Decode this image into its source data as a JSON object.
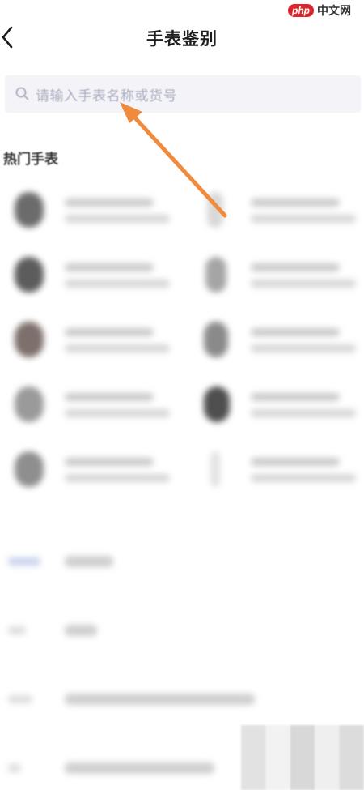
{
  "header": {
    "title": "手表鉴别",
    "back_icon": "chevron-left-icon"
  },
  "watermark": {
    "logo": "php",
    "text": "中文网"
  },
  "search": {
    "placeholder": "请输入手表名称或货号",
    "icon": "search-icon"
  },
  "section": {
    "title": "热门手表"
  },
  "colors": {
    "accent_arrow": "#f08a3c",
    "search_bg": "#f4f4f8",
    "placeholder": "#a9acc0"
  }
}
